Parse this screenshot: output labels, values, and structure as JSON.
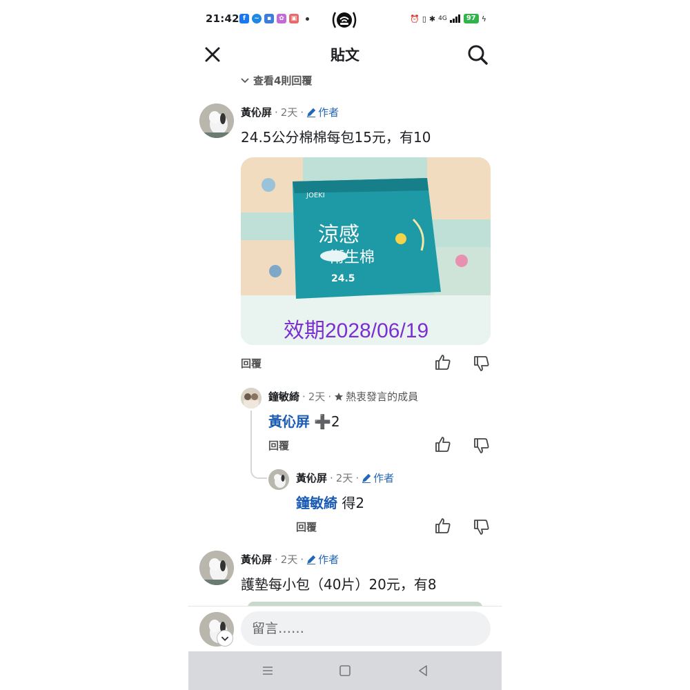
{
  "status_bar": {
    "time": "21:42",
    "battery": "97",
    "network": "4G"
  },
  "header": {
    "title": "貼文"
  },
  "view_replies": "查看4則回覆",
  "comments": [
    {
      "name": "黃伈屏",
      "time": "2天",
      "badge": "作者",
      "text": "24.5公分棉棉每包15元，有10",
      "photo_caption": "效期2028/06/19",
      "reply": "回覆"
    },
    {
      "name": "鐘敏綺",
      "time": "2天",
      "badge": "熱衷發言的成員",
      "mention": "黃伈屏",
      "emoji": "➕",
      "text": "2",
      "reply": "回覆"
    },
    {
      "name": "黃伈屏",
      "time": "2天",
      "badge": "作者",
      "mention": "鐘敏綺",
      "text": "得2",
      "reply": "回覆"
    },
    {
      "name": "黃伈屏",
      "time": "2天",
      "badge": "作者",
      "text": "護墊每小包（40片）20元，有8"
    }
  ],
  "composer": {
    "placeholder": "留言……"
  },
  "colors": {
    "link_blue": "#1a5bb5",
    "caption_purple": "#7b2fd2",
    "battery_green": "#2fb34a"
  }
}
